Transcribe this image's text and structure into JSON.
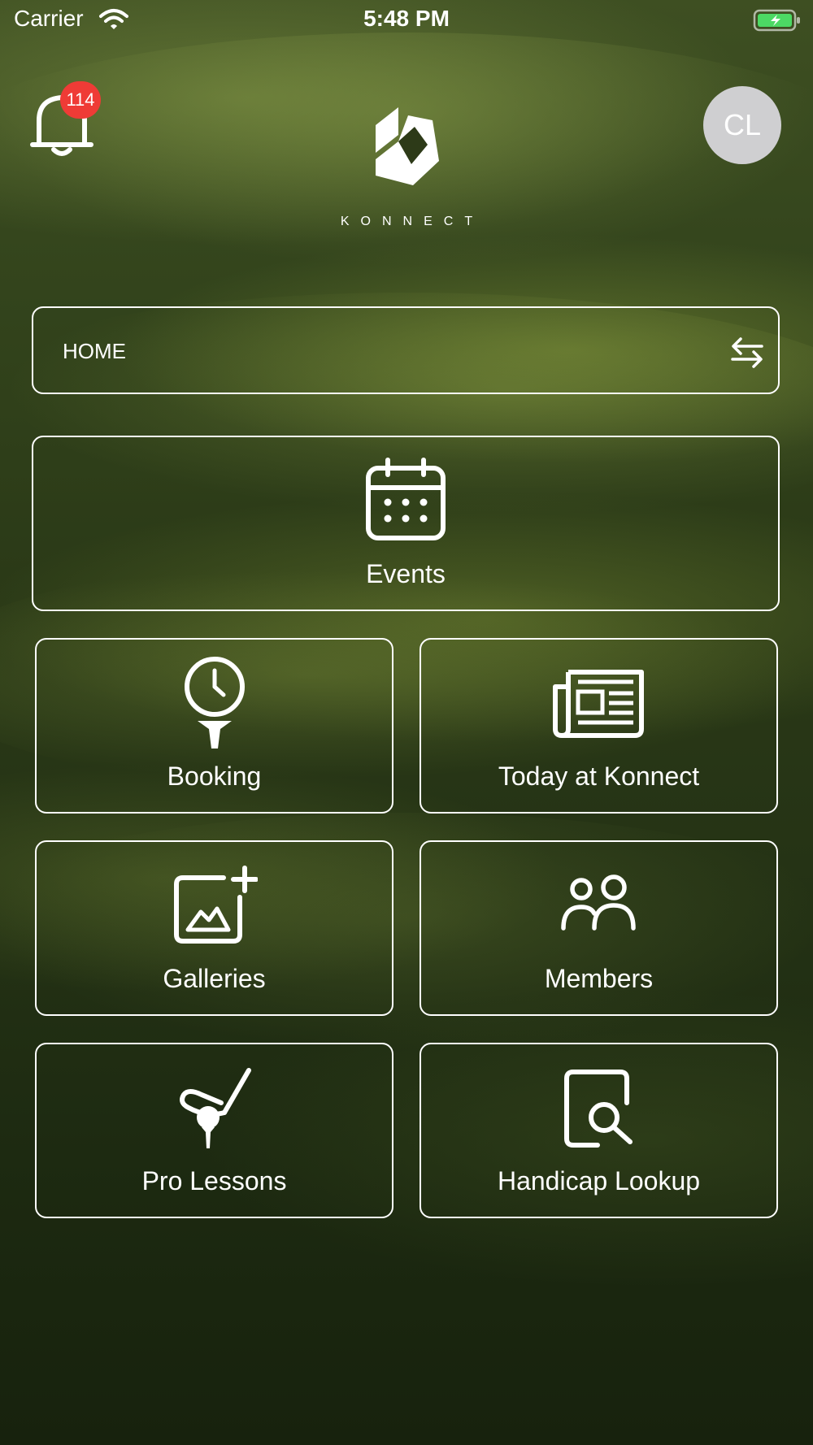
{
  "status_bar": {
    "carrier": "Carrier",
    "time": "5:48 PM"
  },
  "header": {
    "notification_count": "114",
    "logo_text": "KONNECT",
    "avatar_initials": "CL"
  },
  "selector": {
    "label": "HOME"
  },
  "tiles": [
    {
      "label": "Events",
      "icon": "calendar-icon"
    },
    {
      "label": "Booking",
      "icon": "golf-tee-clock-icon"
    },
    {
      "label": "Today at Konnect",
      "icon": "newspaper-icon"
    },
    {
      "label": "Galleries",
      "icon": "add-photo-icon"
    },
    {
      "label": "Members",
      "icon": "members-icon"
    },
    {
      "label": "Pro Lessons",
      "icon": "golf-club-ball-icon"
    },
    {
      "label": "Handicap Lookup",
      "icon": "document-search-icon"
    }
  ],
  "colors": {
    "badge": "#ef3b36",
    "avatar_bg": "#cfcfd1",
    "battery_fill": "#4cd964",
    "tile_border": "#ffffff"
  }
}
